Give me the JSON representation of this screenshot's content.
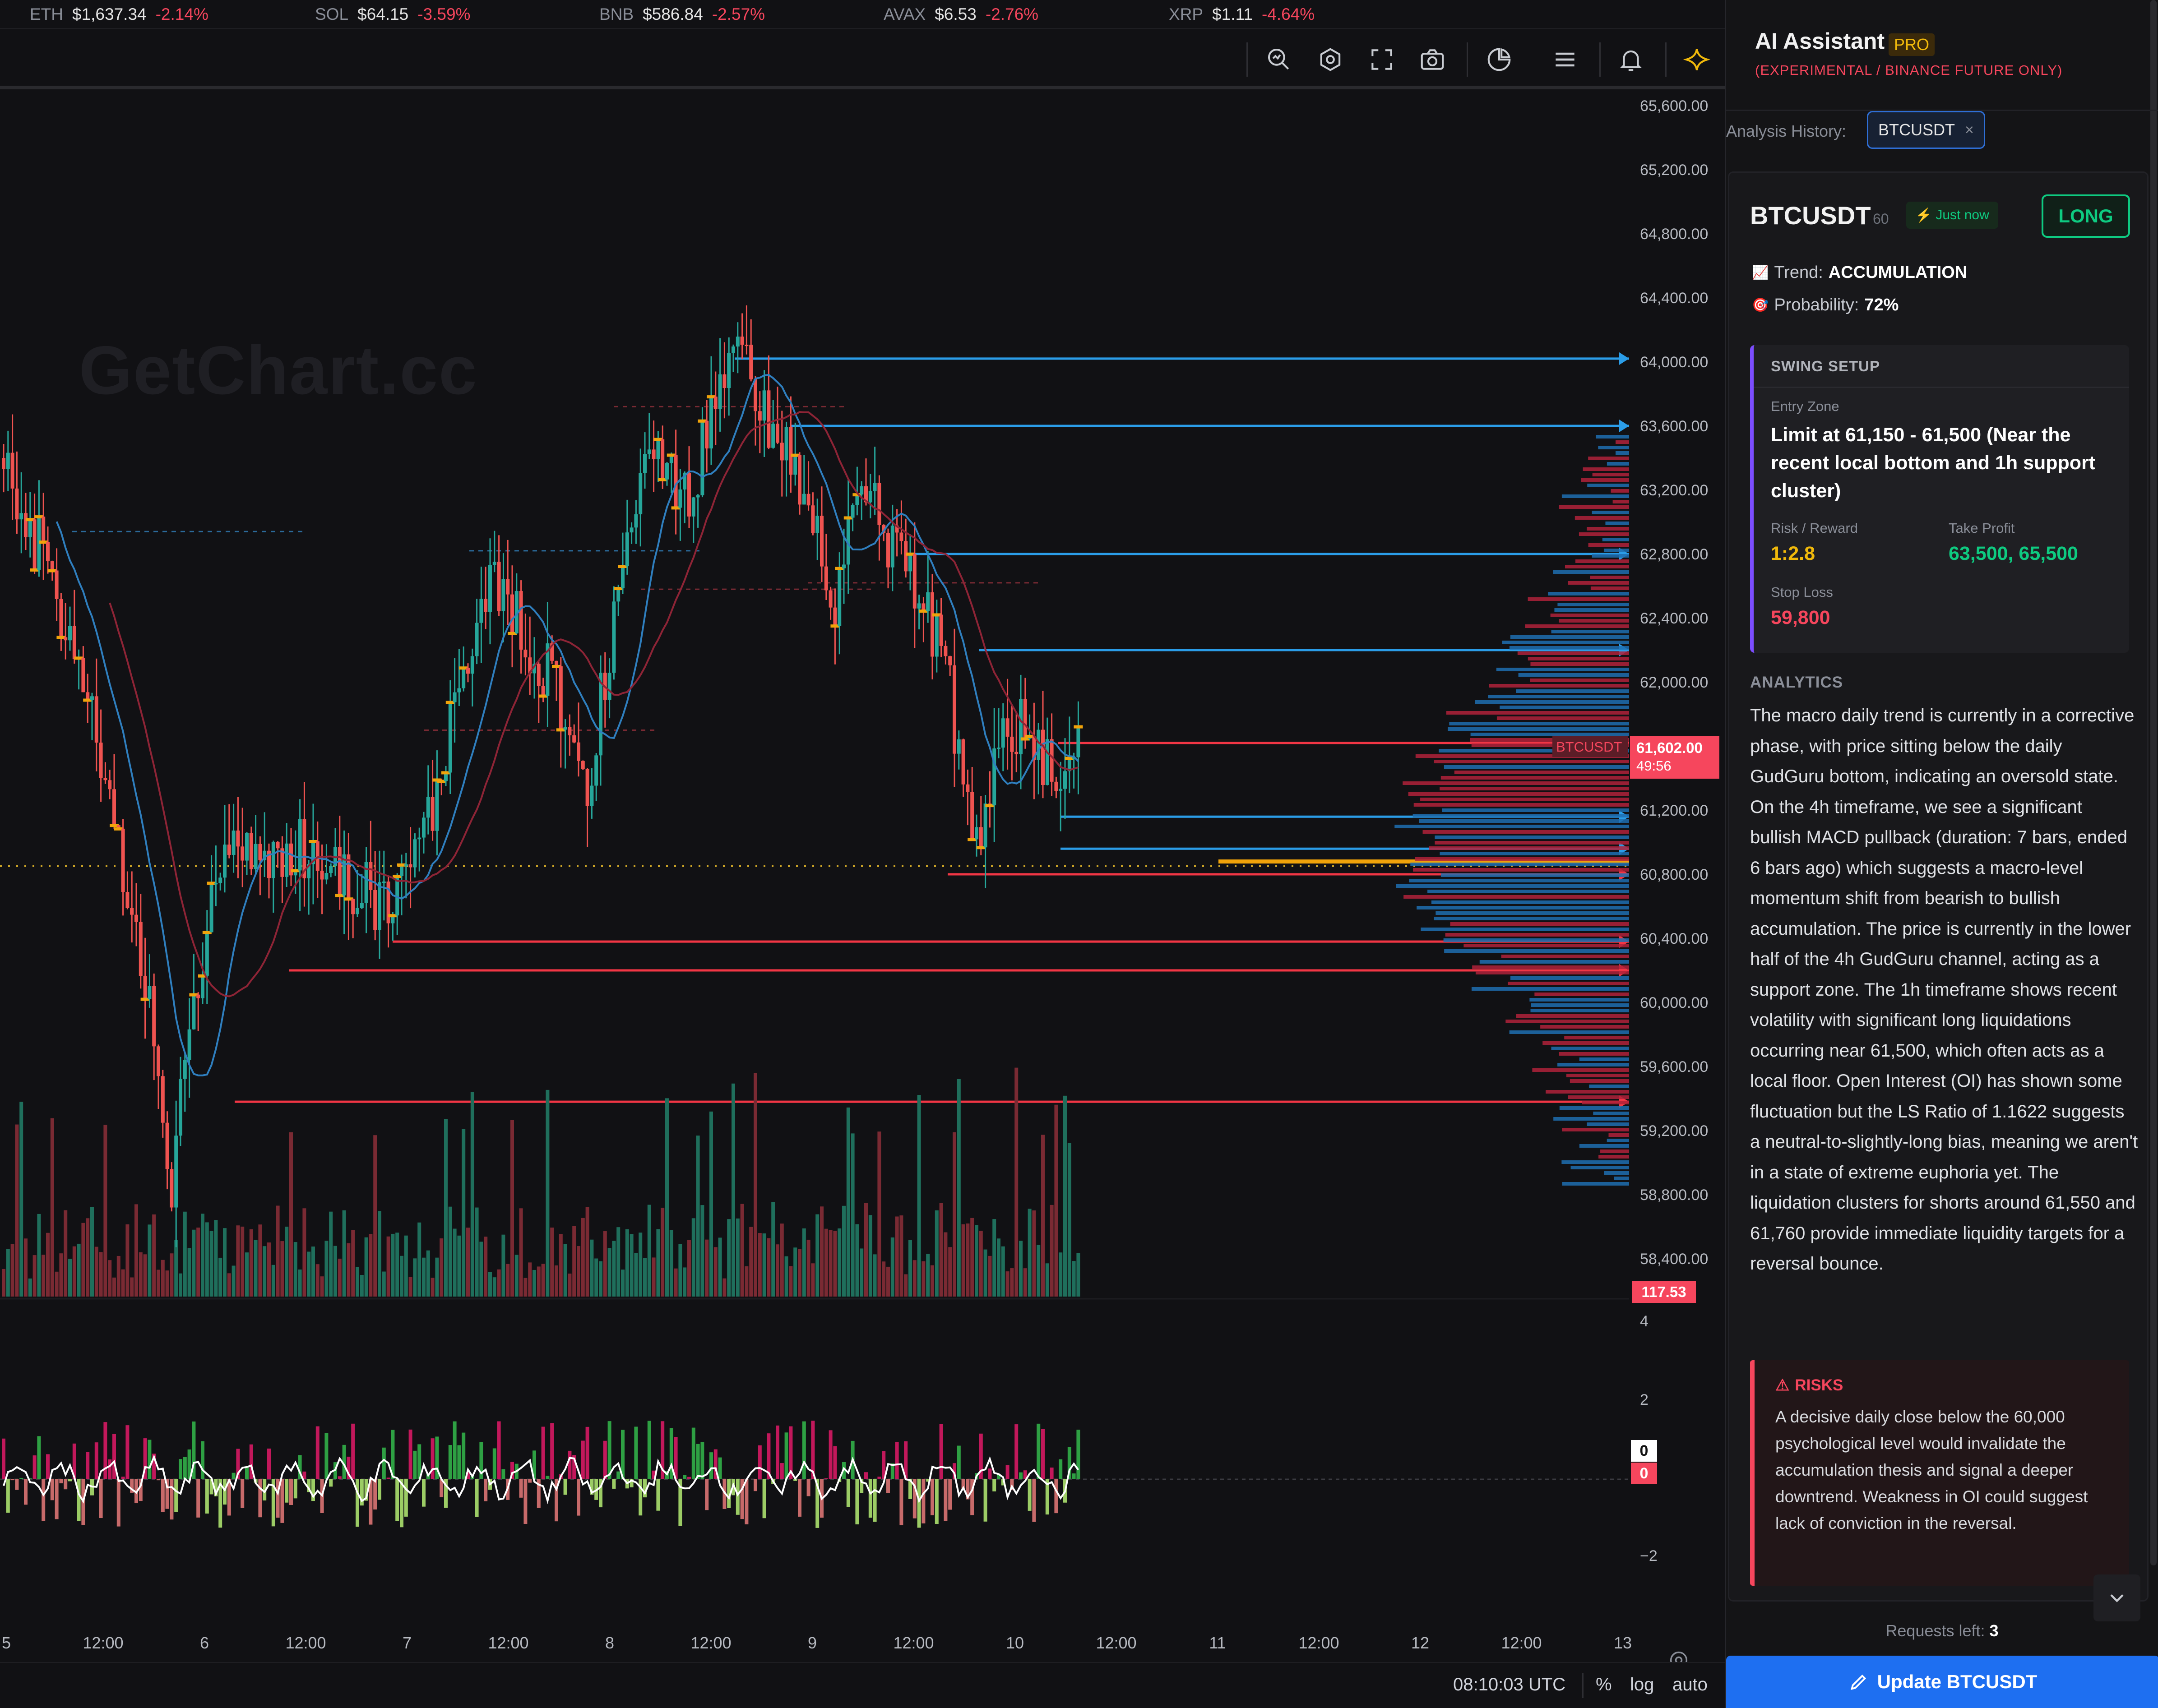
{
  "ticker": [
    {
      "symbol": "ETH",
      "price": "$1,637.34",
      "change": "-2.14%"
    },
    {
      "symbol": "SOL",
      "price": "$64.15",
      "change": "-3.59%"
    },
    {
      "symbol": "BNB",
      "price": "$586.84",
      "change": "-2.57%"
    },
    {
      "symbol": "AVAX",
      "price": "$6.53",
      "change": "-2.76%"
    },
    {
      "symbol": "XRP",
      "price": "$1.11",
      "change": "-4.64%"
    }
  ],
  "toolbar": {
    "icons": [
      "search-analytics-icon",
      "settings-hex-icon",
      "fullscreen-icon",
      "camera-icon",
      "pie-chart-icon",
      "menu-icon",
      "bell-icon",
      "sparkle-icon"
    ]
  },
  "watermark": "GetChart.cc",
  "chart": {
    "price_labels": [
      "65,600.00",
      "65,200.00",
      "64,800.00",
      "64,400.00",
      "64,000.00",
      "63,600.00",
      "63,200.00",
      "62,800.00",
      "62,400.00",
      "62,000.00",
      "61,200.00",
      "60,800.00",
      "60,400.00",
      "60,000.00",
      "59,600.00",
      "59,200.00",
      "58,800.00",
      "58,400.00"
    ],
    "time_labels": [
      "5",
      "12:00",
      "6",
      "12:00",
      "7",
      "12:00",
      "8",
      "12:00",
      "9",
      "12:00",
      "10",
      "12:00",
      "11",
      "12:00",
      "12",
      "12:00",
      "13"
    ],
    "last_price": "61,602.00",
    "countdown": "49:56",
    "symbol_tag": "BTCUSDT",
    "volume_tag": "117.53",
    "osc_labels": [
      "4",
      "2",
      "−2"
    ],
    "osc_tag_white": "0",
    "osc_tag_red": "0",
    "colors": {
      "up": "#26a69a",
      "down": "#ef5350",
      "vol_up": "#1f6f5c",
      "vol_down": "#7a2a33",
      "level_blue": "#2b9de8",
      "level_red": "#f23645",
      "level_orange": "#f0a30a"
    }
  },
  "bottom_bar": {
    "clock": "08:10:03 UTC",
    "percent": "%",
    "log": "log",
    "auto": "auto"
  },
  "panel": {
    "title": "AI Assistant",
    "badge": "PRO",
    "subtitle": "(EXPERIMENTAL / BINANCE FUTURE ONLY)",
    "history_label": "Analysis History:",
    "history_chip": "BTCUSDT",
    "history_chip_close": "×",
    "card": {
      "symbol": "BTCUSDT",
      "timeframe": "60",
      "time": "Just now",
      "direction": "LONG",
      "trend_label": "Trend:",
      "trend_value": "ACCUMULATION",
      "prob_label": "Probability:",
      "prob_value": "72%",
      "setup_title": "SWING SETUP",
      "entry_label": "Entry Zone",
      "entry_value": "Limit at 61,150 - 61,500 (Near the recent local bottom and 1h support cluster)",
      "rr_label": "Risk / Reward",
      "rr_value": "1:2.8",
      "tp_label": "Take Profit",
      "tp_value": "63,500, 65,500",
      "sl_label": "Stop Loss",
      "sl_value": "59,800",
      "analytics_title": "ANALYTICS",
      "analytics_text": "The macro daily trend is currently in a corrective phase, with price sitting below the daily GudGuru bottom, indicating an oversold state. On the 4h timeframe, we see a significant bullish MACD pullback (duration: 7 bars, ended 6 bars ago) which suggests a macro-level momentum shift from bearish to bullish accumulation. The price is currently in the lower half of the 4h GudGuru channel, acting as a support zone. The 1h timeframe shows recent volatility with significant long liquidations occurring near 61,500, which often acts as a local floor. Open Interest (OI) has shown some fluctuation but the LS Ratio of 1.1622 suggests a neutral-to-slightly-long bias, meaning we aren't in a state of extreme euphoria yet. The liquidation clusters for shorts around 61,550 and 61,760 provide immediate liquidity targets for a reversal bounce.",
      "risks_title": "RISKS",
      "risks_text": "A decisive daily close below the 60,000 psychological level would invalidate the accumulation thesis and signal a deeper downtrend. Weakness in OI could suggest lack of conviction in the reversal."
    },
    "requests_label": "Requests left:",
    "requests_value": "3",
    "update_button": "Update BTCUSDT"
  }
}
